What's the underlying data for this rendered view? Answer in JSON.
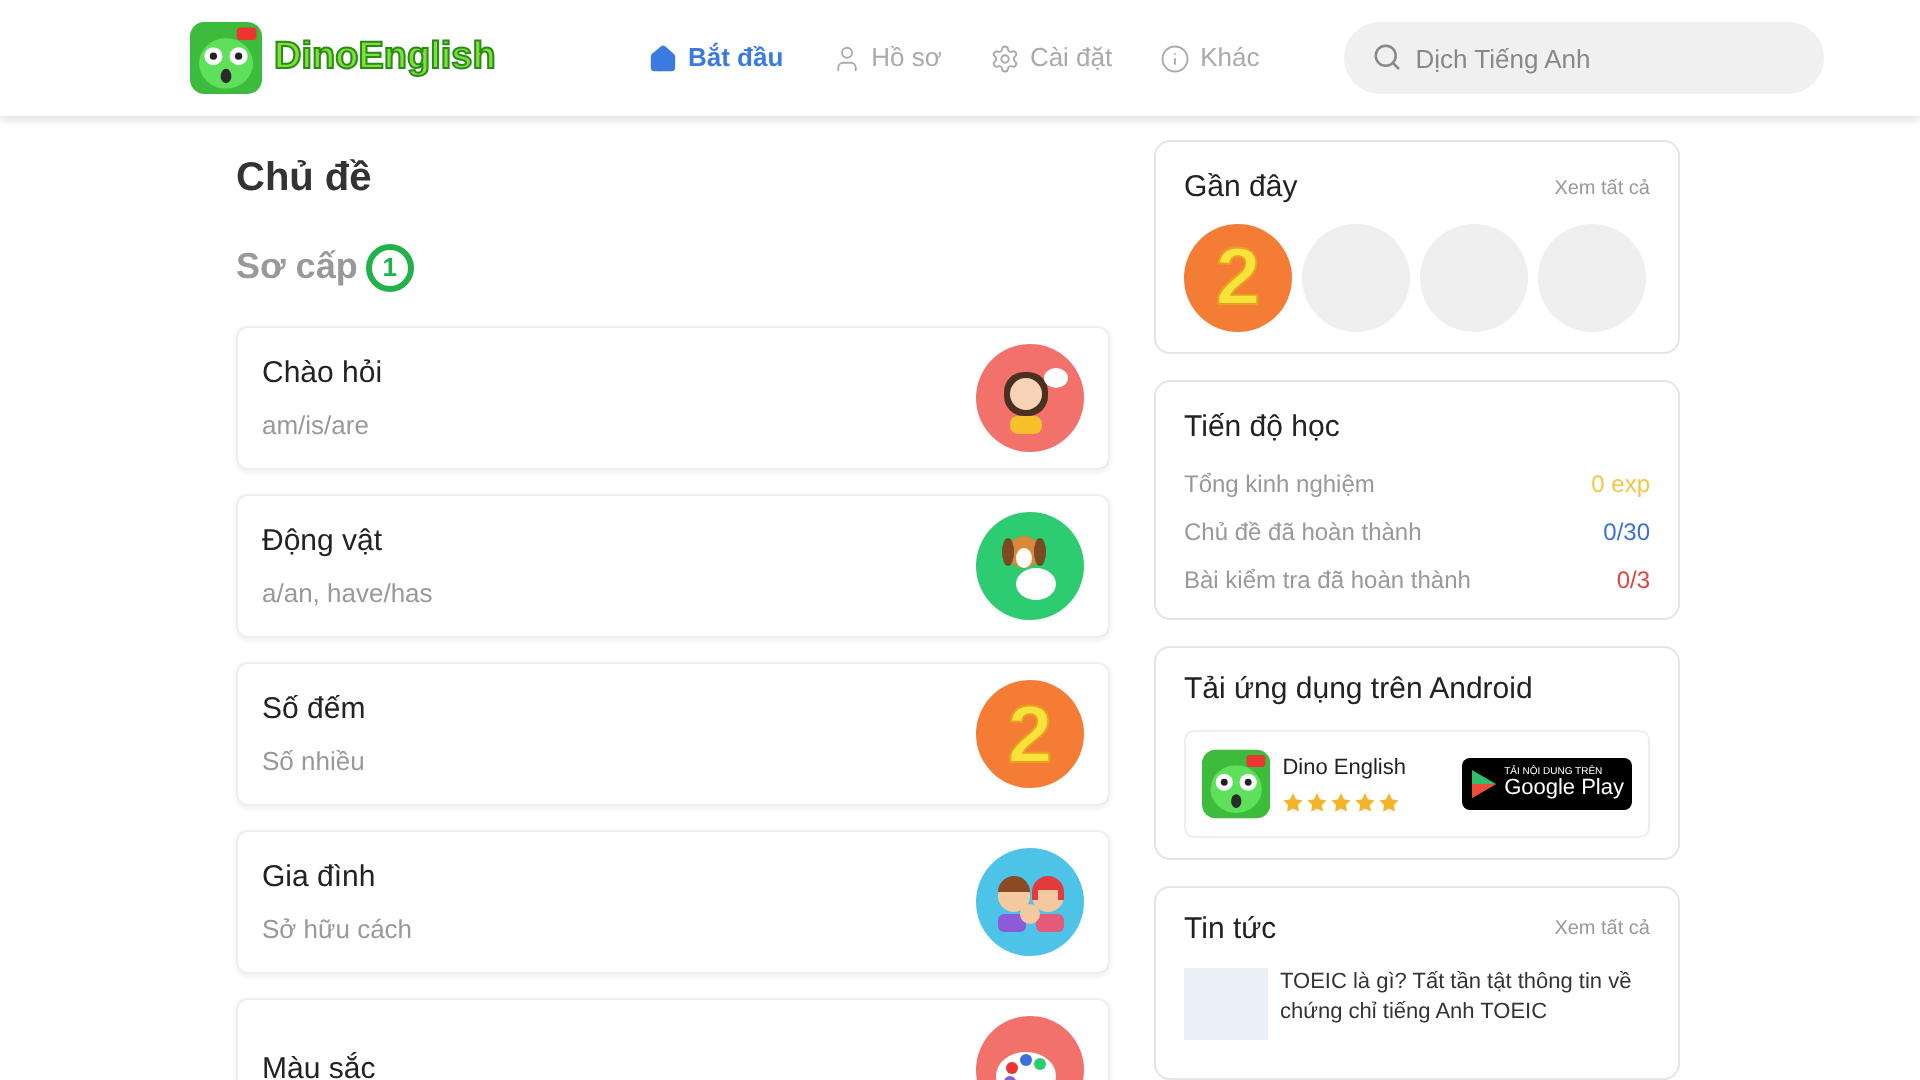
{
  "header": {
    "logo_text": "DinoEnglish",
    "nav": [
      {
        "label": "Bắt đầu",
        "kind": "home",
        "selected": true
      },
      {
        "label": "Hồ sơ",
        "kind": "user",
        "selected": false
      },
      {
        "label": "Cài đặt",
        "kind": "gear",
        "selected": false
      },
      {
        "label": "Khác",
        "kind": "info",
        "selected": false
      }
    ],
    "search": {
      "placeholder": "Dịch Tiếng Anh"
    }
  },
  "main": {
    "title": "Chủ đề",
    "level": {
      "label": "Sơ cấp",
      "badge": "1"
    },
    "topics": [
      {
        "title": "Chào hỏi",
        "subtitle": "am/is/are",
        "kind": "girl",
        "color": "#f2726b"
      },
      {
        "title": "Động vật",
        "subtitle": "a/an, have/has",
        "kind": "dog",
        "color": "#2ecc71"
      },
      {
        "title": "Số đếm",
        "subtitle": "Số nhiều",
        "kind": "number",
        "color": "#f57c35",
        "glyph": "2"
      },
      {
        "title": "Gia đình",
        "subtitle": "Sở hữu cách",
        "kind": "family",
        "color": "#4dc3e8"
      },
      {
        "title": "Màu sắc",
        "kind": "palette",
        "color": "#f2726b"
      }
    ]
  },
  "recent": {
    "title": "Gần đây",
    "link": "Xem tất cả",
    "items": [
      {
        "kind": "number",
        "glyph": "2"
      },
      {
        "kind": "empty"
      },
      {
        "kind": "empty"
      },
      {
        "kind": "empty"
      }
    ]
  },
  "progress": {
    "title": "Tiến độ học",
    "rows": [
      {
        "label": "Tổng kinh nghiệm",
        "value": "0 exp",
        "color": "#f5c542"
      },
      {
        "label": "Chủ đề đã hoàn thành",
        "value": "0/30",
        "color": "#3b6fd8"
      },
      {
        "label": "Bài kiểm tra đã hoàn thành",
        "value": "0/3",
        "color": "#e0443e"
      }
    ]
  },
  "android": {
    "title": "Tải ứng dụng trên Android",
    "app_name": "Dino English",
    "stars": 5,
    "badge_top": "TẢI NỘI DUNG TRÊN",
    "badge_main": "Google Play"
  },
  "news": {
    "title": "Tin tức",
    "link": "Xem tất cả",
    "items": [
      {
        "text": "TOEIC là gì? Tất tần tật thông tin về chứng chỉ tiếng Anh TOEIC"
      }
    ]
  }
}
